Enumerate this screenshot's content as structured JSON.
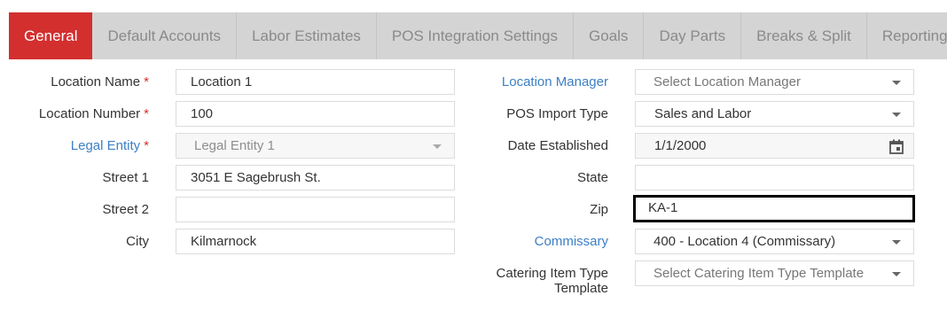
{
  "tabs": [
    {
      "label": "General",
      "active": true
    },
    {
      "label": "Default Accounts"
    },
    {
      "label": "Labor Estimates"
    },
    {
      "label": "POS Integration Settings"
    },
    {
      "label": "Goals"
    },
    {
      "label": "Day Parts"
    },
    {
      "label": "Breaks & Split"
    },
    {
      "label": "Reporting Categ"
    }
  ],
  "required_mark": "*",
  "form": {
    "location_name": {
      "label": "Location Name",
      "value": "Location 1"
    },
    "location_number": {
      "label": "Location Number",
      "value": "100"
    },
    "legal_entity": {
      "label": "Legal Entity",
      "value": "Legal Entity 1"
    },
    "street1": {
      "label": "Street 1",
      "value": "3051 E Sagebrush St."
    },
    "street2": {
      "label": "Street 2",
      "value": ""
    },
    "city": {
      "label": "City",
      "value": "Kilmarnock"
    },
    "location_manager": {
      "label": "Location Manager",
      "placeholder": "Select Location Manager"
    },
    "pos_import_type": {
      "label": "POS Import Type",
      "value": "Sales and Labor"
    },
    "date_established": {
      "label": "Date Established",
      "value": "1/1/2000"
    },
    "state": {
      "label": "State",
      "value": ""
    },
    "zip": {
      "label": "Zip",
      "value": "KA-1"
    },
    "commissary": {
      "label": "Commissary",
      "value": "400 - Location 4 (Commissary)"
    },
    "catering_template": {
      "label_line1": "Catering Item Type",
      "label_line2": "Template",
      "placeholder": "Select Catering Item Type Template"
    }
  },
  "colors": {
    "accent": "#d32f2f",
    "link": "#3d7fc4",
    "tab_bg": "#d4d4d4"
  },
  "icons": {
    "dropdown": "caret-down",
    "date": "calendar"
  }
}
